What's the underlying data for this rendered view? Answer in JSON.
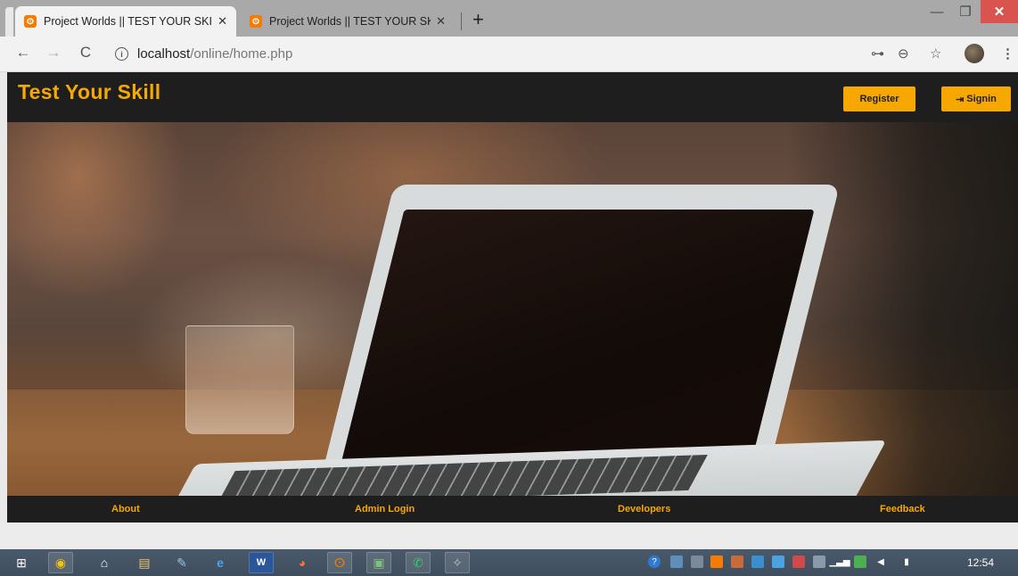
{
  "browser": {
    "tabs": [
      {
        "title": "Project Worlds || TEST YOUR SKIL",
        "favicon": "xampp-icon",
        "active": true
      },
      {
        "title": "Project Worlds || TEST YOUR SKIL",
        "favicon": "xampp-icon",
        "active": false
      }
    ],
    "tab_close_glyph": "✕",
    "new_tab_glyph": "+",
    "url_host": "localhost",
    "url_path": "/online/home.php",
    "glyphs": {
      "back": "←",
      "forward": "→",
      "reload": "C",
      "info": "i",
      "key": "⊶",
      "zoom": "⊖",
      "star": "☆",
      "menu": "⋮",
      "minimize": "—",
      "maximize": "❐",
      "close": "✕"
    }
  },
  "site": {
    "title": "Test Your Skill",
    "register_label": "Register",
    "signin_label": "Signin",
    "signin_icon": "⇥",
    "accent_color": "#f7a800",
    "header_bg": "#1e1e1e"
  },
  "footer_nav": {
    "about": "About",
    "admin_login": "Admin Login",
    "developers": "Developers",
    "feedback": "Feedback"
  },
  "taskbar": {
    "clock": "12:54",
    "apps": [
      "windows-start-icon",
      "chrome-icon",
      "home-icon",
      "file-explorer-icon",
      "pen-icon",
      "edge-icon",
      "word-icon",
      "firefox-icon",
      "xampp-icon",
      "image-viewer-icon",
      "whatsapp-icon",
      "settings-icon"
    ],
    "glyphs": {
      "start": "⊞",
      "chrome": "◉",
      "home": "⌂",
      "explorer": "▤",
      "pen": "✎",
      "edge": "e",
      "word": "W",
      "firefox": "◕",
      "xampp": "ⵙ",
      "image": "▣",
      "whatsapp": "✆",
      "misc": "✧"
    }
  }
}
